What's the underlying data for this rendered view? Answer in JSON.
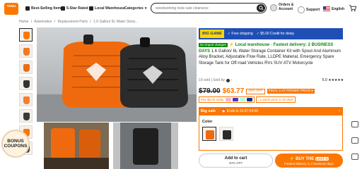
{
  "header": {
    "logo_text": "TEMU",
    "nav": [
      {
        "label": "Best-Selling Items",
        "icon": "thumbs-up-icon"
      },
      {
        "label": "5-Star Rated",
        "icon": "star-icon"
      },
      {
        "label": "Local Warehouse",
        "icon": "truck-icon"
      },
      {
        "label": "Categories",
        "icon": "chevron-down-icon"
      }
    ],
    "search_placeholder": "woodworking tools sale clearance",
    "account_line1": "Orders &",
    "account_line2": "Account",
    "support": "Support",
    "language": "English"
  },
  "breadcrumb": [
    "Home",
    "/",
    "Automotive",
    "/",
    "Replacement Parts",
    "/",
    "1.6 Gallon/ 6L Water Stora..."
  ],
  "bonus": {
    "line1": "BONUS",
    "line2": "COUPONS"
  },
  "banner": {
    "label": "BIG GAME",
    "free_shipping": "✓ Free shipping",
    "credit": "✓ $5.00 Credit for delay"
  },
  "product": {
    "tag": "No import charges",
    "local": "⚡ Local warehouse · Fastest delivery: 2 BUSINESS DAYS",
    "title": " 1.6 Gallon/ 6L Water Storage Container Kit with Spout And Aluminum Alloy Bracket, Adjustable Flow Rate, LLDPE Material, Emergency Spare Storage Tank for Off-road Vehicles RVs SUV ATV Motorcycle",
    "sold": "19 sold | Sold by",
    "rating": "5.0",
    "stars": "★★★★★"
  },
  "price": {
    "old": "$79.00",
    "new": "$63.77",
    "discount": "20% OFF",
    "promo": "FINAL 1.47 PROMO PRICE ▸"
  },
  "payment": {
    "pay_text": "Pay $0.00 today",
    "lowest": "↓ Lowest price in 30 days"
  },
  "sale": {
    "label": "Big sale",
    "ends": "⏰ Ends in 23:07:04:00"
  },
  "color": {
    "label": "Color"
  },
  "actions": {
    "add_cart": "Add to cart",
    "add_cart_sub": "20% OFF",
    "buy_now": "⚡ BUY THE",
    "buy_badge": "LAST 1!",
    "buy_sub": "Fastest delivery in 2 business days"
  },
  "colors": {
    "accent": "#fb7701",
    "banner": "#1f4fb5",
    "green": "#0a8a0a"
  }
}
